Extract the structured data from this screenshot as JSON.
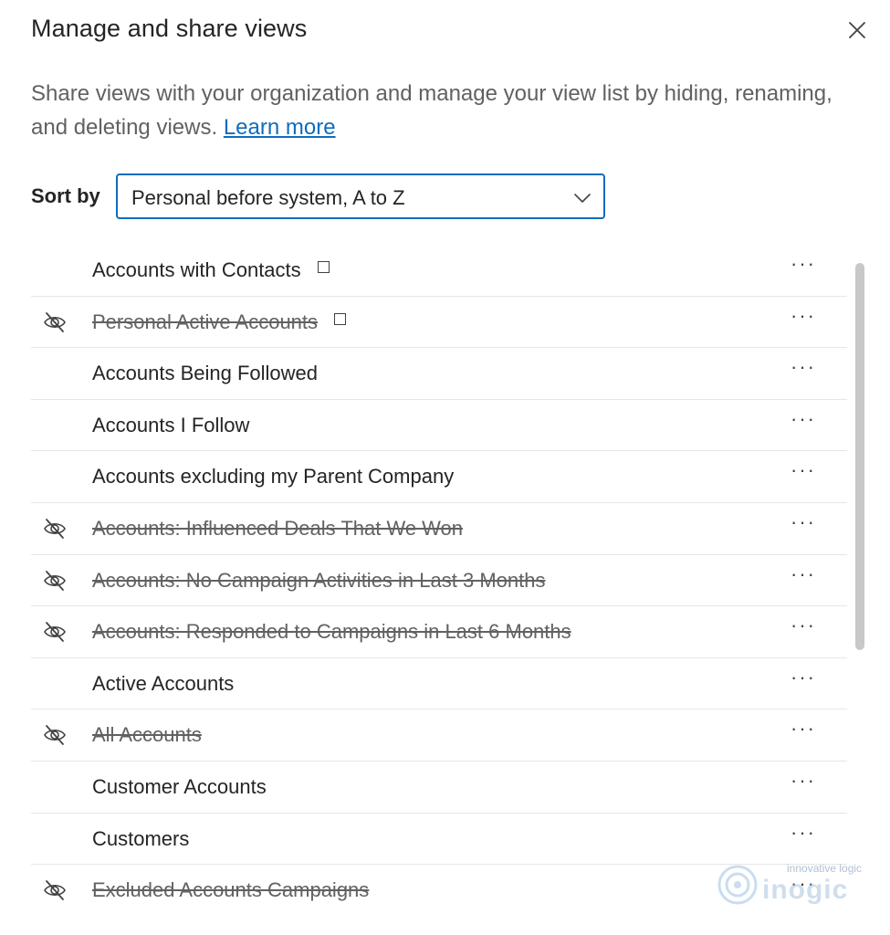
{
  "dialog": {
    "title": "Manage and share views",
    "description": "Share views with your organization and manage your view list by hiding, renaming, and deleting views.",
    "learn_more": "Learn more",
    "close_icon": "close-icon"
  },
  "sort": {
    "label": "Sort by",
    "selected": "Personal before system, A to Z",
    "icon": "chevron-down-icon"
  },
  "views": [
    {
      "label": "Accounts with Contacts",
      "hidden": false,
      "default": true
    },
    {
      "label": "Personal Active Accounts",
      "hidden": true,
      "default": true
    },
    {
      "label": "Accounts Being Followed",
      "hidden": false,
      "default": false
    },
    {
      "label": "Accounts I Follow",
      "hidden": false,
      "default": false
    },
    {
      "label": "Accounts excluding my Parent Company",
      "hidden": false,
      "default": false
    },
    {
      "label": "Accounts: Influenced Deals That We Won",
      "hidden": true,
      "default": false
    },
    {
      "label": "Accounts: No Campaign Activities in Last 3 Months",
      "hidden": true,
      "default": false
    },
    {
      "label": "Accounts: Responded to Campaigns in Last 6 Months",
      "hidden": true,
      "default": false
    },
    {
      "label": "Active Accounts",
      "hidden": false,
      "default": false
    },
    {
      "label": "All Accounts",
      "hidden": true,
      "default": false
    },
    {
      "label": "Customer Accounts",
      "hidden": false,
      "default": false
    },
    {
      "label": "Customers",
      "hidden": false,
      "default": false
    },
    {
      "label": "Excluded Accounts Campaigns",
      "hidden": true,
      "default": false
    }
  ],
  "more_label": "···",
  "watermark": {
    "tagline": "innovative logic",
    "name": "inogic"
  },
  "colors": {
    "accent": "#0f6cbd",
    "text": "#242424",
    "muted": "#616161",
    "divider": "#e6e6e6"
  }
}
